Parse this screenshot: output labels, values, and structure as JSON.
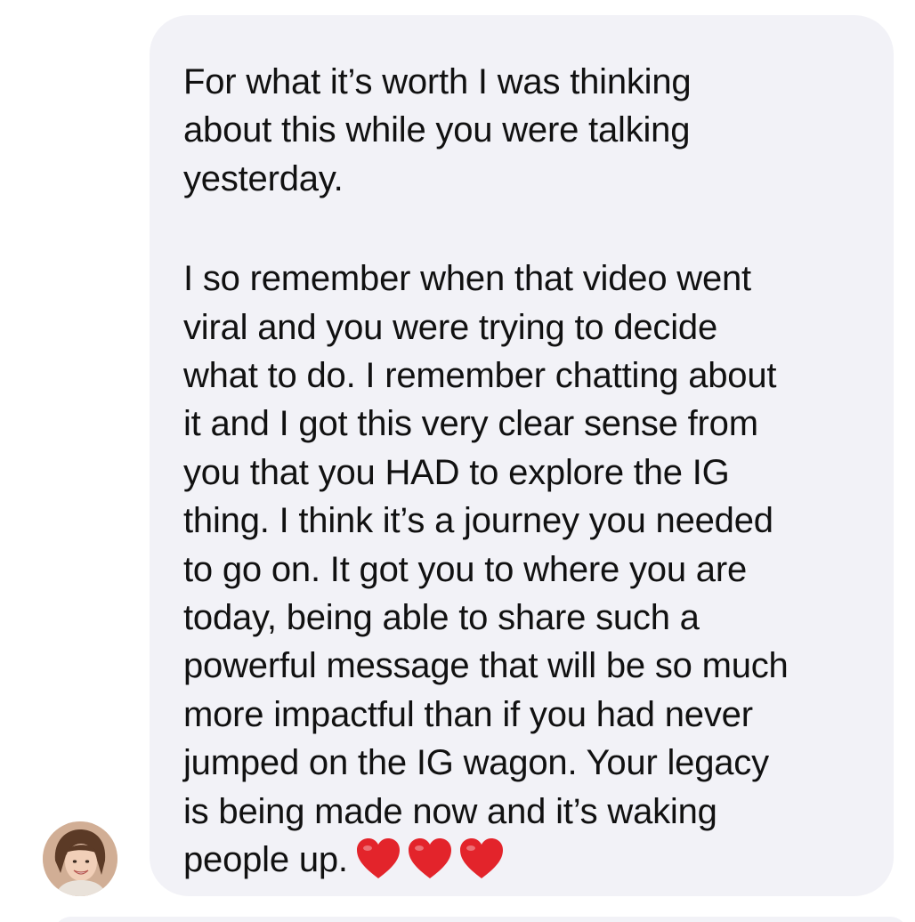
{
  "message": {
    "paragraph_1": "For what it’s worth I was thinking\nabout this while you were talking\nyesterday.",
    "paragraph_2": "I so remember when that video went\nviral and you were trying to decide\nwhat to do. I remember chatting about\nit and I got this very clear sense from\nyou that you HAD to explore the IG\nthing. I think it’s a journey you needed\nto go on. It got you to where you are\ntoday, being able to share such a\npowerful message that will be so much\nmore impactful than if you had never\njumped on the IG wagon. Your legacy\nis being made now and it’s waking\npeople up.",
    "emoji": [
      "heart-emoji",
      "heart-emoji",
      "heart-emoji"
    ]
  },
  "colors": {
    "bubble_background": "#f2f2f7",
    "text": "#111111",
    "heart": "#e3242b"
  },
  "sender": {
    "avatar_icon": "person-avatar"
  }
}
